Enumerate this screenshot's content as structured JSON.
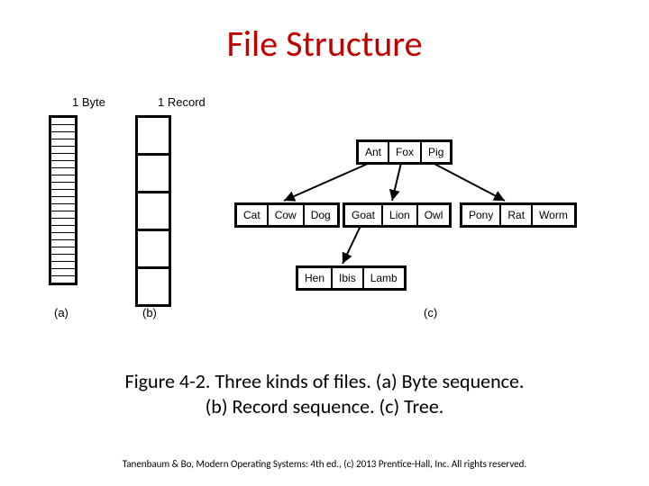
{
  "title": "File Structure",
  "labels": {
    "byte": "1 Byte",
    "record": "1 Record",
    "sub_a": "(a)",
    "sub_b": "(b)",
    "sub_c": "(c)"
  },
  "tree": {
    "row0": [
      "Ant",
      "Fox",
      "Pig"
    ],
    "row1a": [
      "Cat",
      "Cow",
      "Dog"
    ],
    "row1b": [
      "Goat",
      "Lion",
      "Owl"
    ],
    "row1c": [
      "Pony",
      "Rat",
      "Worm"
    ],
    "row2": [
      "Hen",
      "Ibis",
      "Lamb"
    ]
  },
  "caption_line1": "Figure 4-2. Three kinds of files. (a) Byte sequence.",
  "caption_line2": "(b) Record sequence. (c) Tree.",
  "footer": "Tanenbaum & Bo, Modern Operating Systems: 4th ed., (c) 2013 Prentice-Hall, Inc. All rights reserved."
}
